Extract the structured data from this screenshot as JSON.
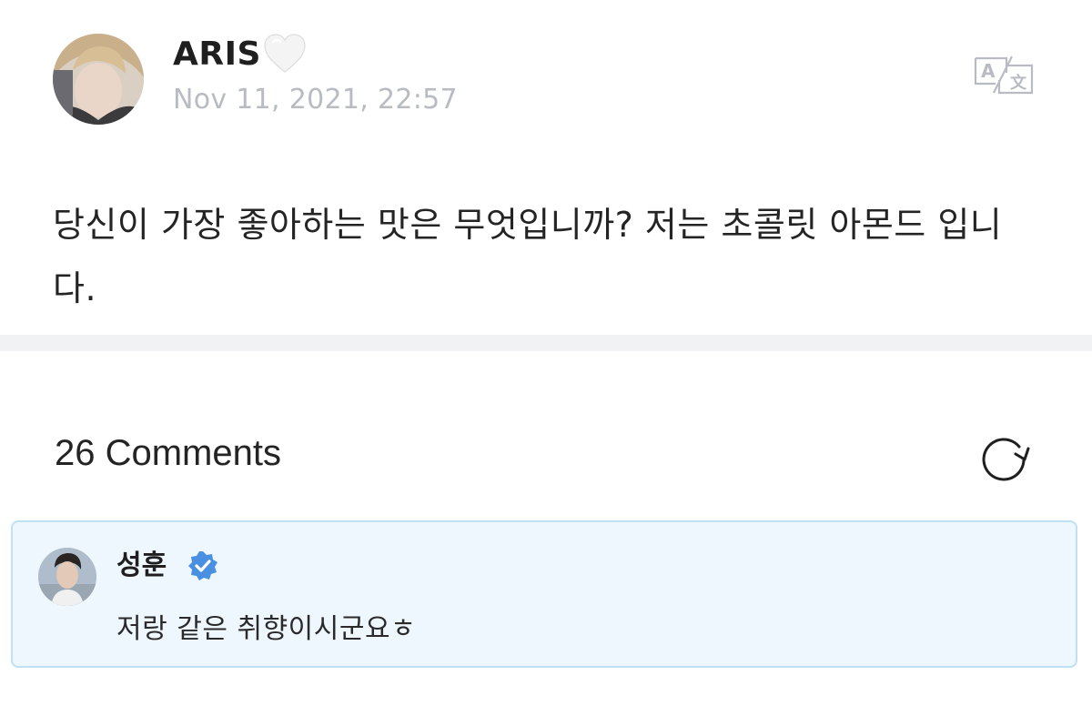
{
  "post": {
    "author": "ARIS",
    "author_icon": "white-heart-icon",
    "date": "Nov 11, 2021, 22:57",
    "body": "당신이 가장 좋아하는 맛은 무엇입니까? 저는 초콜릿 아몬드 입니다.",
    "translate_icon": "translate-icon"
  },
  "comments": {
    "count_label": "26 Comments",
    "refresh_icon": "refresh-icon",
    "items": [
      {
        "author": "성훈",
        "verified_icon": "verified-badge-icon",
        "text": "저랑 같은 취향이시군요ㅎ"
      }
    ]
  },
  "colors": {
    "date_gray": "#b8bcc2",
    "divider": "#f1f2f4",
    "highlight_bg": "#eef7fd",
    "highlight_border": "#bfe1f3",
    "verified_blue": "#4a90e2"
  }
}
